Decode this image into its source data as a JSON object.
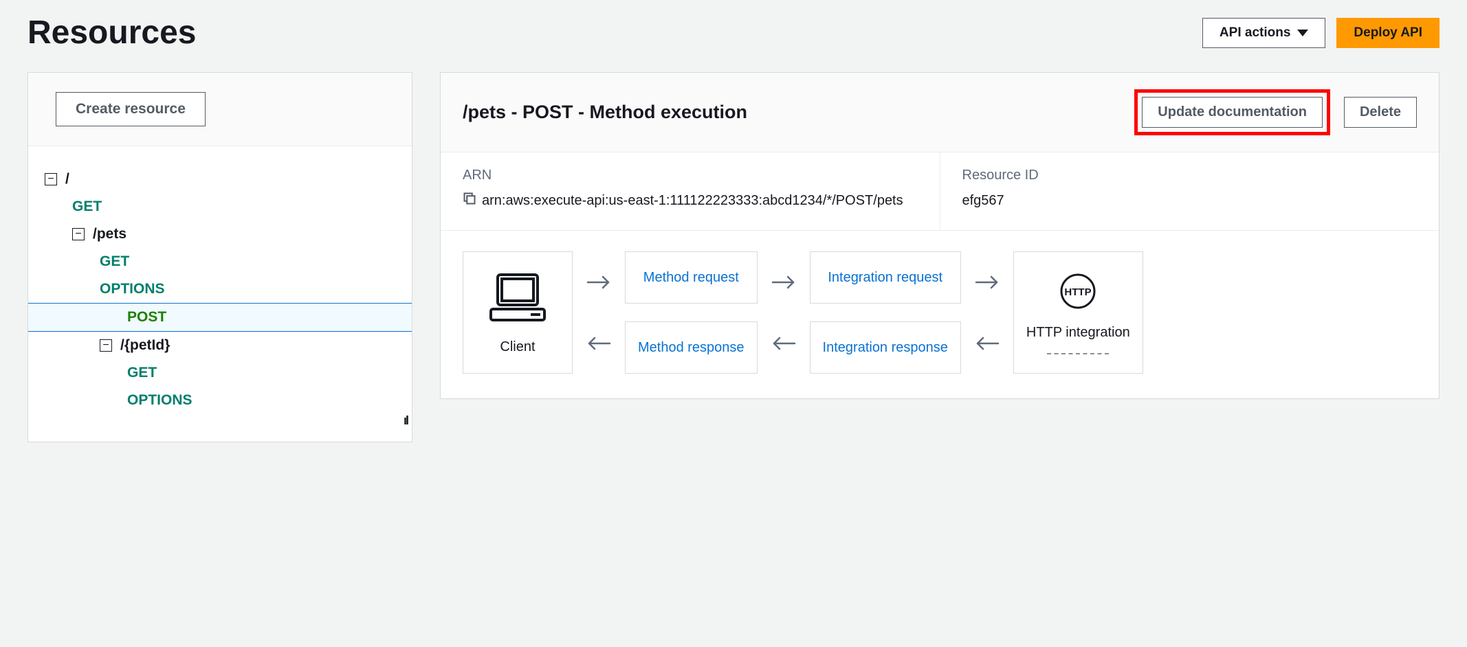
{
  "header": {
    "title": "Resources",
    "api_actions_label": "API actions",
    "deploy_label": "Deploy API"
  },
  "sidebar": {
    "create_label": "Create resource",
    "tree": {
      "root": "/",
      "root_get": "GET",
      "pets": "/pets",
      "pets_get": "GET",
      "pets_options": "OPTIONS",
      "pets_post": "POST",
      "petid": "/{petId}",
      "petid_get": "GET",
      "petid_options": "OPTIONS"
    }
  },
  "panel": {
    "title": "/pets - POST - Method execution",
    "update_doc_label": "Update documentation",
    "delete_label": "Delete",
    "arn_label": "ARN",
    "arn_value": "arn:aws:execute-api:us-east-1:111122223333:abcd1234/*/POST/pets",
    "resource_id_label": "Resource ID",
    "resource_id_value": "efg567"
  },
  "flow": {
    "client_label": "Client",
    "method_request": "Method request",
    "integration_request": "Integration request",
    "method_response": "Method response",
    "integration_response": "Integration response",
    "http_badge": "HTTP",
    "http_label": "HTTP integration"
  }
}
